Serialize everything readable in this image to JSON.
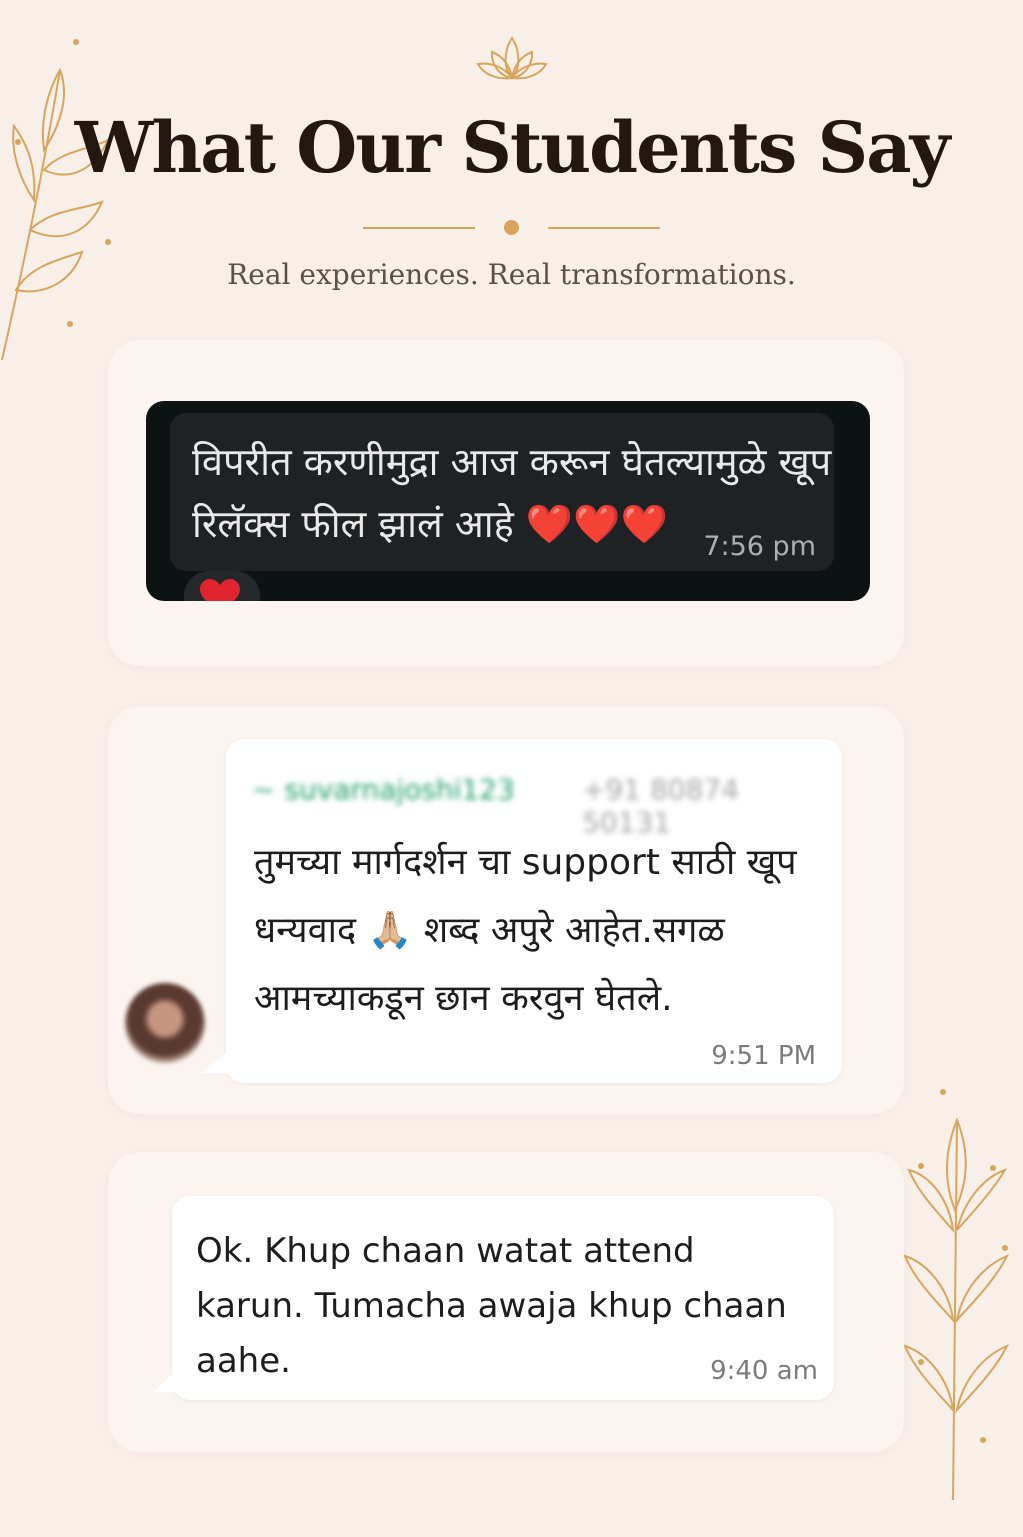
{
  "header": {
    "title": "What Our Students Say",
    "subtitle": "Real experiences. Real transformations."
  },
  "colors": {
    "background": "#f8efe9",
    "accent_gold": "#d7a55c",
    "title": "#24170f"
  },
  "testimonials": [
    {
      "theme": "dark",
      "message": "विपरीत करणीमुद्रा आज करून घेतल्यामुळे खूप रिलॅक्स फील झालं आहे ❤️❤️❤️",
      "time": "7:56 pm",
      "reaction": "heart-icon"
    },
    {
      "theme": "light",
      "sender_name": "~ suvarnajoshi123",
      "sender_phone": "+91 80874 50131",
      "message": "तुमच्या मार्गदर्शन चा support साठी खूप धन्यवाद 🙏🏼 शब्द अपुरे आहेत.सगळ आमच्याकडून छान करवुन घेतले.",
      "time": "9:51 PM"
    },
    {
      "theme": "light",
      "message": "Ok. Khup chaan watat attend karun. Tumacha awaja khup chaan aahe.",
      "time": "9:40 am"
    }
  ]
}
